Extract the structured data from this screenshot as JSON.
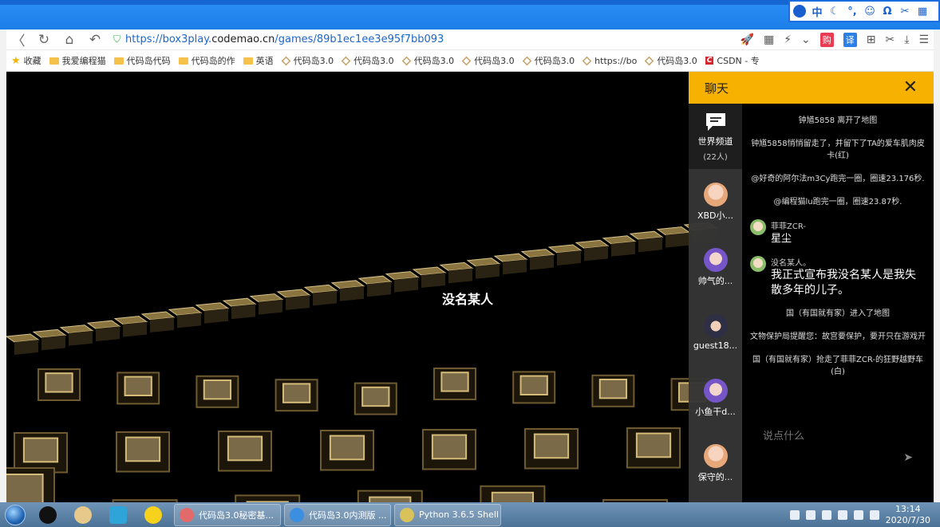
{
  "ime": {
    "items": [
      "中",
      "☾",
      "°,",
      "☺",
      "Ω",
      "✂",
      "▦"
    ]
  },
  "browser": {
    "url_prefix": "https://box3play.",
    "url_domain": "codemao.cn",
    "url_path": "/games/89b1ec1ee3e95f7bb093",
    "back_icon": "〈",
    "refresh_icon": "↻",
    "home_icon": "⌂",
    "undo_icon": "↶",
    "ext_red": "购",
    "ext_blue": "译"
  },
  "bookmarks": [
    {
      "label": "收藏",
      "icon": "star"
    },
    {
      "label": "我爱编程猫",
      "icon": "folder"
    },
    {
      "label": "代码岛代码",
      "icon": "folder"
    },
    {
      "label": "代码岛的作",
      "icon": "folder"
    },
    {
      "label": "英语",
      "icon": "folder"
    },
    {
      "label": "代码岛3.0",
      "icon": "cube"
    },
    {
      "label": "代码岛3.0",
      "icon": "cube"
    },
    {
      "label": "代码岛3.0",
      "icon": "cube"
    },
    {
      "label": "代码岛3.0",
      "icon": "cube"
    },
    {
      "label": "代码岛3.0",
      "icon": "cube"
    },
    {
      "label": "https://bo",
      "icon": "cube"
    },
    {
      "label": "代码岛3.0",
      "icon": "cube"
    },
    {
      "label": "CSDN - 专",
      "icon": "csdn"
    }
  ],
  "game": {
    "player_name": "没名某人"
  },
  "chat": {
    "title": "聊天",
    "close": "✕",
    "channels": [
      {
        "name": "世界频道",
        "sub": "(22人)"
      },
      {
        "name": "XBD小..."
      },
      {
        "name": "帅气的..."
      },
      {
        "name": "guest18..."
      },
      {
        "name": "小鱼干d..."
      },
      {
        "name": "保守的..."
      }
    ],
    "messages": {
      "sys1": "钟馗5858 离开了地图",
      "sys2": "钟馗5858悄悄留走了，并留下了TA的爱车肌肉皮卡(红)",
      "sys3": "@好奇的阿尔法m3Cy跑完一圈，圈速23.176秒.",
      "sys4": "@编程猫lu跑完一圈，圈速23.87秒.",
      "m1_name": "菲菲ZCR-",
      "m1_text": "星尘",
      "m2_name": "没名某人。",
      "m2_text": "我正式宣布我没名某人是我失散多年的儿子。",
      "sys5": "国（有国就有家）进入了地图",
      "sys6": "文物保护局提醒您：故宫要保护，要开只在游戏开",
      "sys7": "国（有国就有家）抢走了菲菲ZCR-的狂野越野车(白)"
    },
    "input_placeholder": "说点什么",
    "send_icon": "➤"
  },
  "taskbar": {
    "tasks": [
      {
        "label": "代码岛3.0秘密基..."
      },
      {
        "label": "代码岛3.0内测版 ..."
      },
      {
        "label": "Python 3.6.5 Shell"
      }
    ],
    "time": "13:14",
    "date": "2020/7/30"
  },
  "colors": {
    "chat_header": "#f7b100",
    "titlebar": "#1c7fe9",
    "taskbar": "#5b82a8"
  }
}
